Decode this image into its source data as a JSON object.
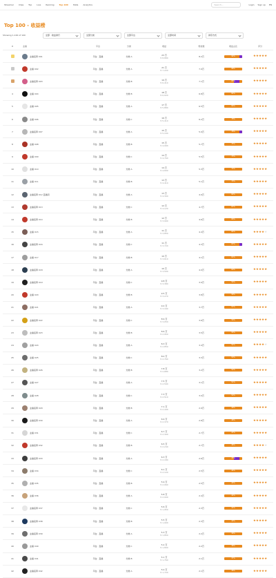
{
  "nav": {
    "items": [
      "Streamer",
      "Clips",
      "Top",
      "Live",
      "Ranking",
      "Top 100",
      "Stats",
      "Analytics"
    ],
    "active_index": 5,
    "search_placeholder": "Search...",
    "right_links": [
      "Login",
      "Sign up",
      "EN"
    ]
  },
  "page": {
    "title": "Top 100 - 收益榜"
  },
  "filters": {
    "label": "Showing 1-100 of 100",
    "options": [
      "全部 · 收益排行",
      "全部分类",
      "全部平台",
      "全部时间",
      "排序方式"
    ]
  },
  "table": {
    "columns": [
      "#",
      "主播",
      "平台",
      "分类",
      "收益",
      "粉丝数",
      "收益占比",
      "评分"
    ],
    "rows": [
      {
        "rank": "1",
        "name": "主播名称 001",
        "platform": "平台 · 直播",
        "category": "分类 A",
        "value": "23 万",
        "sub": "¥ 8,880",
        "fans": "8.2万",
        "bar": "92%",
        "tip": "end",
        "stars": 5,
        "avatar": "#6b7b8c"
      },
      {
        "rank": "2",
        "name": "主播 002",
        "platform": "平台 · 直播",
        "category": "分类 A",
        "value": "21 万",
        "sub": "¥ 7,220",
        "fans": "7.9万",
        "bar": "88%",
        "tip": "none",
        "stars": 5,
        "avatar": "#c0392b"
      },
      {
        "rank": "3",
        "name": "主播名称 003",
        "platform": "平台 · 直播",
        "category": "分类 B",
        "value": "19 万",
        "sub": "¥ 6,410",
        "fans": "7.1万",
        "bar": "85%",
        "tip": "mid",
        "stars": 5,
        "avatar": "#d35f8a"
      },
      {
        "rank": "4",
        "name": "主播 004",
        "platform": "平台 · 直播",
        "category": "分类 B",
        "value": "18 万",
        "sub": "¥ 6,020",
        "fans": "6.8万",
        "bar": "82%",
        "tip": "none",
        "stars": 5,
        "avatar": "#111111"
      },
      {
        "rank": "5",
        "name": "主播 005",
        "platform": "平台 · 直播",
        "category": "分类 A",
        "value": "17 万",
        "sub": "¥ 5,880",
        "fans": "6.5万",
        "bar": "80%",
        "tip": "none",
        "stars": 5,
        "avatar": "#e6e6e6"
      },
      {
        "rank": "6",
        "name": "主播 006",
        "platform": "平台 · 直播",
        "category": "分类 C",
        "value": "16 万",
        "sub": "¥ 5,410",
        "fans": "6.2万",
        "bar": "78%",
        "tip": "none",
        "stars": 5,
        "avatar": "#8a8a8a"
      },
      {
        "rank": "7",
        "name": "主播名称 007",
        "platform": "平台 · 直播",
        "category": "分类 A",
        "value": "15 万",
        "sub": "¥ 5,100",
        "fans": "5.9万",
        "bar": "76%",
        "tip": "end",
        "stars": 5,
        "avatar": "#b7b7b7"
      },
      {
        "rank": "8",
        "name": "主播 008",
        "platform": "平台 · 直播",
        "category": "分类 B",
        "value": "15 万",
        "sub": "¥ 4,990",
        "fans": "5.7万",
        "bar": "75%",
        "tip": "none",
        "stars": 5,
        "avatar": "#a93226"
      },
      {
        "rank": "9",
        "name": "主播 009",
        "platform": "平台 · 直播",
        "category": "分类 C",
        "value": "14 万",
        "sub": "¥ 4,760",
        "fans": "5.5万",
        "bar": "73%",
        "tip": "none",
        "stars": 5,
        "avatar": "#c0392b"
      },
      {
        "rank": "10",
        "name": "主播 010",
        "platform": "平台 · 直播",
        "category": "分类 A",
        "value": "14 万",
        "sub": "¥ 4,600",
        "fans": "5.3万",
        "bar": "72%",
        "tip": "none",
        "stars": 5,
        "avatar": "#e0e0e0"
      },
      {
        "rank": "11",
        "name": "主播 011",
        "platform": "平台 · 直播",
        "category": "分类 B",
        "value": "13 万",
        "sub": "¥ 4,410",
        "fans": "5.1万",
        "bar": "70%",
        "tip": "none",
        "stars": 5,
        "avatar": "#9aa0a6"
      },
      {
        "rank": "12",
        "name": "主播名称 012 直播间",
        "platform": "平台 · 直播",
        "category": "分类 A",
        "value": "13 万",
        "sub": "¥ 4,300",
        "fans": "4.9万",
        "bar": "69%",
        "tip": "none",
        "stars": 5,
        "avatar": "#5a6470"
      },
      {
        "rank": "13",
        "name": "主播名称 013",
        "platform": "平台 · 直播",
        "category": "分类 C",
        "value": "12 万",
        "sub": "¥ 4,120",
        "fans": "4.7万",
        "bar": "67%",
        "tip": "none",
        "stars": 5,
        "avatar": "#b03a2e"
      },
      {
        "rank": "14",
        "name": "主播名称 014",
        "platform": "平台 · 直播",
        "category": "分类 B",
        "value": "12 万",
        "sub": "¥ 3,990",
        "fans": "4.6万",
        "bar": "66%",
        "tip": "none",
        "stars": 5,
        "avatar": "#c0392b"
      },
      {
        "rank": "15",
        "name": "主播 015",
        "platform": "平台 · 直播",
        "category": "分类 A",
        "value": "11 万",
        "sub": "¥ 3,850",
        "fans": "4.4万",
        "bar": "64%",
        "tip": "none",
        "stars": 4,
        "avatar": "#7b5e57"
      },
      {
        "rank": "16",
        "name": "主播名称 016",
        "platform": "平台 · 直播",
        "category": "分类 C",
        "value": "11 万",
        "sub": "¥ 3,720",
        "fans": "4.3万",
        "bar": "63%",
        "tip": "end",
        "stars": 5,
        "avatar": "#444444"
      },
      {
        "rank": "17",
        "name": "主播 017",
        "platform": "平台 · 直播",
        "category": "分类 B",
        "value": "10 万",
        "sub": "¥ 3,610",
        "fans": "4.1万",
        "bar": "61%",
        "tip": "none",
        "stars": 5,
        "avatar": "#9e9e9e"
      },
      {
        "rank": "18",
        "name": "主播名称 018",
        "platform": "平台 · 直播",
        "category": "分类 A",
        "value": "10 万",
        "sub": "¥ 3,500",
        "fans": "4.0万",
        "bar": "60%",
        "tip": "none",
        "stars": 5,
        "avatar": "#2c3e50"
      },
      {
        "rank": "19",
        "name": "主播名称 019",
        "platform": "平台 · 直播",
        "category": "分类 C",
        "value": "9.8 万",
        "sub": "¥ 3,380",
        "fans": "3.9万",
        "bar": "59%",
        "tip": "none",
        "stars": 5,
        "avatar": "#1f1f1f"
      },
      {
        "rank": "20",
        "name": "主播 020",
        "platform": "平台 · 直播",
        "category": "分类 B",
        "value": "9.5 万",
        "sub": "¥ 3,270",
        "fans": "3.8万",
        "bar": "58%",
        "tip": "none",
        "stars": 5,
        "avatar": "#c0392b"
      },
      {
        "rank": "21",
        "name": "主播 021",
        "platform": "平台 · 直播",
        "category": "分类 A",
        "value": "9.2 万",
        "sub": "¥ 3,160",
        "fans": "3.7万",
        "bar": "57%",
        "tip": "none",
        "stars": 5,
        "avatar": "#8d6e63"
      },
      {
        "rank": "22",
        "name": "主播名称 022",
        "platform": "平台 · 直播",
        "category": "分类 C",
        "value": "8.9 万",
        "sub": "¥ 3,050",
        "fans": "3.6万",
        "bar": "56%",
        "tip": "none",
        "stars": 5,
        "avatar": "#d4a017"
      },
      {
        "rank": "23",
        "name": "主播名称 023",
        "platform": "平台 · 直播",
        "category": "分类 B",
        "value": "8.6 万",
        "sub": "¥ 2,950",
        "fans": "3.5万",
        "bar": "55%",
        "tip": "none",
        "stars": 5,
        "avatar": "#bdbdbd"
      },
      {
        "rank": "24",
        "name": "主播 024",
        "platform": "平台 · 直播",
        "category": "分类 A",
        "value": "8.3 万",
        "sub": "¥ 2,850",
        "fans": "3.4万",
        "bar": "54%",
        "tip": "none",
        "stars": 4,
        "avatar": "#a0a0a0"
      },
      {
        "rank": "25",
        "name": "主播 025",
        "platform": "平台 · 直播",
        "category": "分类 C",
        "value": "8.0 万",
        "sub": "¥ 2,760",
        "fans": "3.3万",
        "bar": "53%",
        "tip": "none",
        "stars": 5,
        "avatar": "#6d6d6d"
      },
      {
        "rank": "26",
        "name": "主播名称 026",
        "platform": "平台 · 直播",
        "category": "分类 B",
        "value": "7.8 万",
        "sub": "¥ 2,680",
        "fans": "3.2万",
        "bar": "52%",
        "tip": "none",
        "stars": 5,
        "avatar": "#c2b280"
      },
      {
        "rank": "27",
        "name": "主播 027",
        "platform": "平台 · 直播",
        "category": "分类 A",
        "value": "7.5 万",
        "sub": "¥ 2,590",
        "fans": "3.1万",
        "bar": "51%",
        "tip": "none",
        "stars": 5,
        "avatar": "#555555"
      },
      {
        "rank": "28",
        "name": "主播 028",
        "platform": "平台 · 直播",
        "category": "分类 C",
        "value": "7.3 万",
        "sub": "¥ 2,510",
        "fans": "3.0万",
        "bar": "50%",
        "tip": "none",
        "stars": 5,
        "avatar": "#7f8c8d"
      },
      {
        "rank": "29",
        "name": "主播名称 029",
        "platform": "平台 · 直播",
        "category": "分类 B",
        "value": "7.1 万",
        "sub": "¥ 2,440",
        "fans": "2.9万",
        "bar": "49%",
        "tip": "none",
        "stars": 5,
        "avatar": "#9c8070"
      },
      {
        "rank": "30",
        "name": "主播名称 030",
        "platform": "平台 · 直播",
        "category": "分类 A",
        "value": "6.9 万",
        "sub": "¥ 2,370",
        "fans": "2.8万",
        "bar": "48%",
        "tip": "none",
        "stars": 5,
        "avatar": "#1a1a1a"
      },
      {
        "rank": "31",
        "name": "主播 031",
        "platform": "平台 · 直播",
        "category": "分类 C",
        "value": "6.7 万",
        "sub": "¥ 2,300",
        "fans": "2.7万",
        "bar": "47%",
        "tip": "none",
        "stars": 5,
        "avatar": "#d6d6d6"
      },
      {
        "rank": "32",
        "name": "主播名称 032",
        "platform": "平台 · 直播",
        "category": "分类 B",
        "value": "6.5 万",
        "sub": "¥ 2,240",
        "fans": "2.7万",
        "bar": "46%",
        "tip": "none",
        "stars": 4,
        "avatar": "#c0392b"
      },
      {
        "rank": "33",
        "name": "主播名称 033",
        "platform": "平台 · 直播",
        "category": "分类 A",
        "value": "6.3 万",
        "sub": "¥ 2,180",
        "fans": "2.6万",
        "bar": "45%",
        "tip": "mid",
        "stars": 5,
        "avatar": "#3d3d3d"
      },
      {
        "rank": "34",
        "name": "主播 034",
        "platform": "平台 · 直播",
        "category": "分类 C",
        "value": "6.1 万",
        "sub": "¥ 2,120",
        "fans": "2.5万",
        "bar": "44%",
        "tip": "none",
        "stars": 5,
        "avatar": "#8c7b6b"
      },
      {
        "rank": "35",
        "name": "主播 035",
        "platform": "平台 · 直播",
        "category": "分类 B",
        "value": "5.9 万",
        "sub": "¥ 2,060",
        "fans": "2.5万",
        "bar": "43%",
        "tip": "none",
        "stars": 5,
        "avatar": "#b0b0b0"
      },
      {
        "rank": "36",
        "name": "主播 036",
        "platform": "平台 · 直播",
        "category": "分类 A",
        "value": "5.8 万",
        "sub": "¥ 2,000",
        "fans": "2.4万",
        "bar": "42%",
        "tip": "none",
        "stars": 5,
        "avatar": "#c7a27a"
      },
      {
        "rank": "37",
        "name": "主播名称 037",
        "platform": "平台 · 直播",
        "category": "分类 C",
        "value": "5.6 万",
        "sub": "¥ 1,950",
        "fans": "2.3万",
        "bar": "41%",
        "tip": "none",
        "stars": 5,
        "avatar": "#e8e8e8"
      },
      {
        "rank": "38",
        "name": "主播名称 038",
        "platform": "平台 · 直播",
        "category": "分类 B",
        "value": "5.5 万",
        "sub": "¥ 1,900",
        "fans": "2.3万",
        "bar": "40%",
        "tip": "none",
        "stars": 5,
        "avatar": "#1e3a5f"
      },
      {
        "rank": "39",
        "name": "主播名称 039",
        "platform": "平台 · 直播",
        "category": "分类 A",
        "value": "5.3 万",
        "sub": "¥ 1,850",
        "fans": "2.2万",
        "bar": "39%",
        "tip": "none",
        "stars": 5,
        "avatar": "#6e6e6e"
      },
      {
        "rank": "40",
        "name": "主播 040",
        "platform": "平台 · 直播",
        "category": "分类 C",
        "value": "5.2 万",
        "sub": "¥ 1,800",
        "fans": "2.2万",
        "bar": "38%",
        "tip": "none",
        "stars": 5,
        "avatar": "#999999"
      },
      {
        "rank": "41",
        "name": "主播 041",
        "platform": "平台 · 直播",
        "category": "分类 B",
        "value": "5.1 万",
        "sub": "¥ 1,760",
        "fans": "2.1万",
        "bar": "37%",
        "tip": "none",
        "stars": 5,
        "avatar": "#4a4a4a"
      },
      {
        "rank": "42",
        "name": "主播名称 042",
        "platform": "平台 · 直播",
        "category": "分类 A",
        "value": "5.0 万",
        "sub": "¥ 1,720",
        "fans": "2.1万",
        "bar": "36%",
        "tip": "none",
        "stars": 5,
        "avatar": "#222222"
      }
    ]
  },
  "colors": {
    "accent": "#e8891d",
    "purple": "#7a2cc6"
  }
}
